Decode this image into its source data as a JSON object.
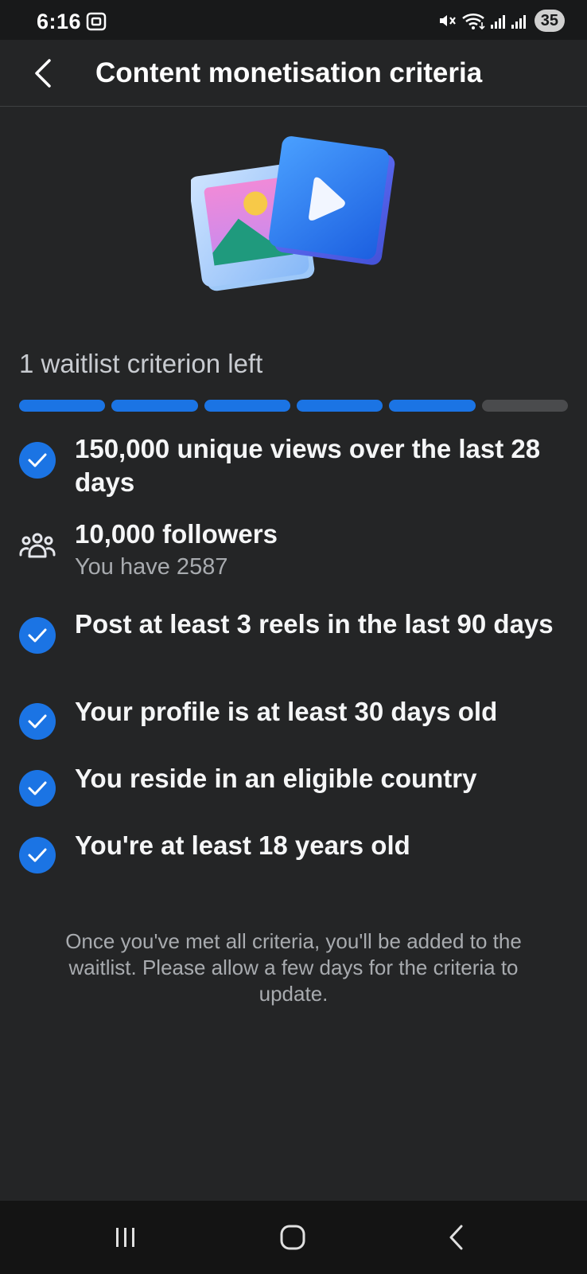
{
  "status_bar": {
    "time": "6:16",
    "battery": "35",
    "icons": [
      "screenshot-icon",
      "mute-icon",
      "wifi-icon",
      "signal-icon",
      "signal-icon"
    ]
  },
  "header": {
    "title": "Content monetisation criteria",
    "back_icon": "chevron-left-icon"
  },
  "progress": {
    "label": "1 waitlist criterion left",
    "completed": 5,
    "total": 6,
    "accent_color": "#1b74e4"
  },
  "criteria": [
    {
      "title": "150,000 unique views over the last 28 days",
      "subtitle": "",
      "met": true,
      "icon": "check-circle-icon"
    },
    {
      "title": "10,000 followers",
      "subtitle": "You have 2587",
      "met": false,
      "icon": "people-icon"
    },
    {
      "title": "Post at least 3 reels in the last 90 days",
      "subtitle": "",
      "met": true,
      "icon": "check-circle-icon"
    },
    {
      "title": "Your profile is at least 30 days old",
      "subtitle": "",
      "met": true,
      "icon": "check-circle-icon"
    },
    {
      "title": "You reside in an eligible country",
      "subtitle": "",
      "met": true,
      "icon": "check-circle-icon"
    },
    {
      "title": "You're at least 18 years old",
      "subtitle": "",
      "met": true,
      "icon": "check-circle-icon"
    }
  ],
  "footnote": "Once you've met all criteria, you'll be added to the waitlist. Please allow a few days for the criteria to update.",
  "nav_bar": {
    "buttons": [
      "recents-icon",
      "home-icon",
      "back-icon"
    ]
  }
}
